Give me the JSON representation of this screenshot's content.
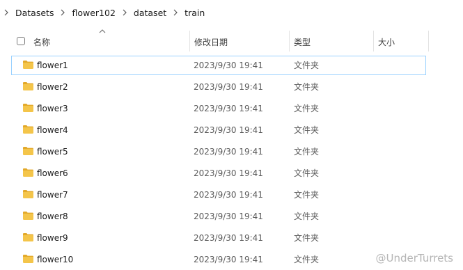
{
  "breadcrumb": {
    "items": [
      "Datasets",
      "flower102",
      "dataset",
      "train"
    ]
  },
  "columns": {
    "name": "名称",
    "date_modified": "修改日期",
    "type": "类型",
    "size": "大小"
  },
  "rows": [
    {
      "name": "flower1",
      "date": "2023/9/30 19:41",
      "type": "文件夹",
      "selected": true
    },
    {
      "name": "flower2",
      "date": "2023/9/30 19:41",
      "type": "文件夹"
    },
    {
      "name": "flower3",
      "date": "2023/9/30 19:41",
      "type": "文件夹"
    },
    {
      "name": "flower4",
      "date": "2023/9/30 19:41",
      "type": "文件夹"
    },
    {
      "name": "flower5",
      "date": "2023/9/30 19:41",
      "type": "文件夹"
    },
    {
      "name": "flower6",
      "date": "2023/9/30 19:41",
      "type": "文件夹"
    },
    {
      "name": "flower7",
      "date": "2023/9/30 19:41",
      "type": "文件夹"
    },
    {
      "name": "flower8",
      "date": "2023/9/30 19:41",
      "type": "文件夹"
    },
    {
      "name": "flower9",
      "date": "2023/9/30 19:41",
      "type": "文件夹"
    },
    {
      "name": "flower10",
      "date": "2023/9/30 19:41",
      "type": "文件夹"
    }
  ],
  "watermark": "@UnderTurrets",
  "colors": {
    "folder": "#f4c54a",
    "folder_dark": "#e3a92a",
    "selection_border": "#99d1ff"
  }
}
